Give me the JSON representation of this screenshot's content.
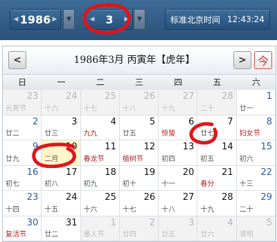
{
  "year_display": "1986",
  "month_display": "3",
  "clock": {
    "label": "标准北京时间",
    "time": "12:43:24"
  },
  "header": {
    "title": "1986年3月  丙寅年【虎年】",
    "prev": "<",
    "next": ">",
    "today": "今"
  },
  "weekdays": [
    "日",
    "一",
    "二",
    "三",
    "四",
    "五",
    "六"
  ],
  "days": [
    {
      "n": "23",
      "l": "元宵节",
      "o": true,
      "f": true
    },
    {
      "n": "24",
      "l": "十六",
      "o": true
    },
    {
      "n": "25",
      "l": "十七",
      "o": true
    },
    {
      "n": "26",
      "l": "十八",
      "o": true
    },
    {
      "n": "27",
      "l": "十九",
      "o": true
    },
    {
      "n": "28",
      "l": "二十",
      "o": true
    },
    {
      "n": "1",
      "l": "廿一"
    },
    {
      "n": "2",
      "l": "廿二"
    },
    {
      "n": "3",
      "l": "廿三"
    },
    {
      "n": "4",
      "l": "九九",
      "f": true
    },
    {
      "n": "5",
      "l": "廿五"
    },
    {
      "n": "6",
      "l": "惊蛰",
      "f": true
    },
    {
      "n": "7",
      "l": "廿七"
    },
    {
      "n": "8",
      "l": "妇女节",
      "f": true
    },
    {
      "n": "9",
      "l": "廿九"
    },
    {
      "n": "10",
      "l": "二月",
      "t": true
    },
    {
      "n": "11",
      "l": "春龙节",
      "f": true
    },
    {
      "n": "12",
      "l": "植树节",
      "f": true
    },
    {
      "n": "13",
      "l": "初四"
    },
    {
      "n": "14",
      "l": "初五"
    },
    {
      "n": "15",
      "l": "初六"
    },
    {
      "n": "16",
      "l": "初七"
    },
    {
      "n": "17",
      "l": "初八"
    },
    {
      "n": "18",
      "l": "初九"
    },
    {
      "n": "19",
      "l": "初十"
    },
    {
      "n": "20",
      "l": "十一"
    },
    {
      "n": "21",
      "l": "春分",
      "f": true
    },
    {
      "n": "22",
      "l": "十三"
    },
    {
      "n": "23",
      "l": "十四"
    },
    {
      "n": "24",
      "l": "十五"
    },
    {
      "n": "25",
      "l": "十六"
    },
    {
      "n": "26",
      "l": "十七"
    },
    {
      "n": "27",
      "l": "十八"
    },
    {
      "n": "28",
      "l": "十九"
    },
    {
      "n": "29",
      "l": "二十"
    },
    {
      "n": "30",
      "l": "复活节",
      "f": true
    },
    {
      "n": "31",
      "l": "廿二"
    },
    {
      "n": "1",
      "l": "愚人节",
      "o": true
    },
    {
      "n": "2",
      "l": "廿四",
      "o": true
    },
    {
      "n": "3",
      "l": "廿五",
      "o": true
    },
    {
      "n": "4",
      "l": "廿六",
      "o": true
    },
    {
      "n": "5",
      "l": "清明",
      "o": true
    }
  ],
  "colors": {
    "circle": "#e0151b",
    "topbar": "#2f5680",
    "festival": "#b02020"
  }
}
